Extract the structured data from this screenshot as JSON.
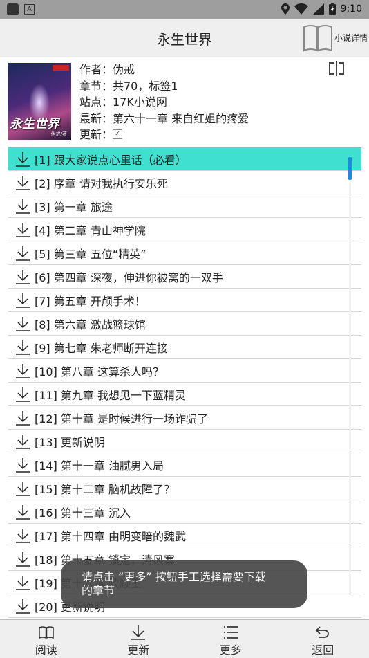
{
  "status_bar": {
    "time": "9:10",
    "icons": [
      "square-icon",
      "a-icon",
      "location-icon",
      "wifi-icon",
      "signal-icon",
      "battery-icon"
    ]
  },
  "app_bar": {
    "title": "永生世界",
    "detail_label": "小说详情"
  },
  "book": {
    "cover_title": "永生世界",
    "cover_author": "伪戒/著",
    "author_line": "作者：伪戒",
    "chapters_line": "章节：共70，标签1",
    "site_line": "站点：17K小说网",
    "latest_line": "最新：第六十一章 来自红姐的疼爱",
    "update_label": "更新：",
    "update_checked": true
  },
  "chapters": [
    {
      "label": "[1]  跟大家说点心里话（必看）",
      "active": true
    },
    {
      "label": "[2]  序章 请对我执行安乐死"
    },
    {
      "label": "[3]  第一章 旅途"
    },
    {
      "label": "[4]  第二章 青山神学院"
    },
    {
      "label": "[5]  第三章 五位“精英”"
    },
    {
      "label": "[6]  第四章 深夜，伸进你被窝的一双手"
    },
    {
      "label": "[7]  第五章 开颅手术！"
    },
    {
      "label": "[8]  第六章 激战篮球馆"
    },
    {
      "label": "[9]  第七章 朱老师断开连接"
    },
    {
      "label": "[10]  第八章 这算杀人吗？"
    },
    {
      "label": "[11]  第九章 我想见一下蓝精灵"
    },
    {
      "label": "[12]  第十章 是时候进行一场诈骗了"
    },
    {
      "label": "[13]  更新说明"
    },
    {
      "label": "[14]  第十一章 油腻男入局"
    },
    {
      "label": "[15]  第十二章 脑机故障了？"
    },
    {
      "label": "[16]  第十三章 沉入"
    },
    {
      "label": "[17]  第十四章 由明变暗的魏武"
    },
    {
      "label": "[18]  第十五章 锁定，清风寨"
    },
    {
      "label": "[19]  第十六章 败顺王"
    },
    {
      "label": "[20]  更新说明"
    }
  ],
  "toast": {
    "line1": "请点击 “更多” 按钮手工选择需要下载",
    "line2": "的章节"
  },
  "bottom_tabs": [
    {
      "label": "阅读",
      "icon": "book-icon"
    },
    {
      "label": "更新",
      "icon": "download-icon"
    },
    {
      "label": "更多",
      "icon": "list-icon"
    },
    {
      "label": "返回",
      "icon": "return-icon"
    }
  ],
  "colors": {
    "active_row": "#40e0d0",
    "scrollbar": "#1e88e5",
    "status_bar": "#9e9e9e",
    "app_bar": "#efefef"
  }
}
